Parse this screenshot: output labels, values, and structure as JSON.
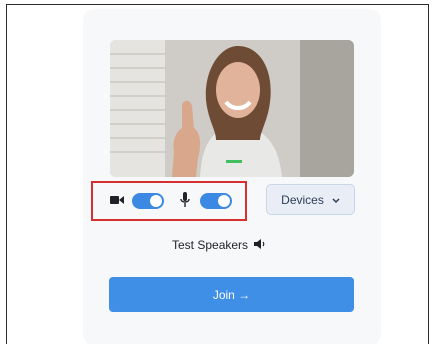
{
  "controls": {
    "camera_icon": "video-camera-icon",
    "camera_on": true,
    "mic_icon": "microphone-icon",
    "mic_on": true
  },
  "devices": {
    "label": "Devices",
    "icon": "chevron-down-icon"
  },
  "test_speakers": {
    "label": "Test Speakers",
    "icon": "speaker-icon"
  },
  "join": {
    "label": "Join →"
  },
  "colors": {
    "accent": "#3b89e3",
    "join_button": "#3f8fe6",
    "highlight": "#d62f2f",
    "devices_bg": "#e9eef6"
  }
}
